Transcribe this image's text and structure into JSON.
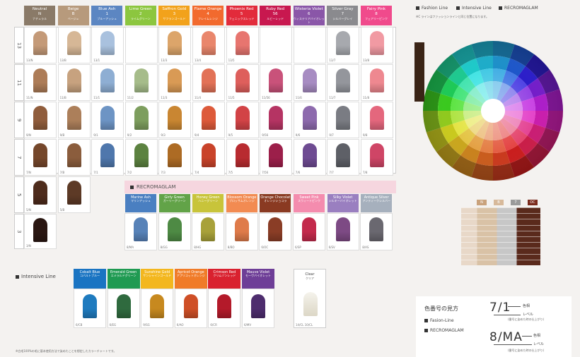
{
  "headers": [
    {
      "name": "Neutral",
      "code": "N",
      "jp": "ナチュラル",
      "color": "#8a7a68"
    },
    {
      "name": "Beige",
      "code": "B",
      "jp": "ベージュ",
      "color": "#b79a7c"
    },
    {
      "name": "Blue Ash",
      "code": "1",
      "jp": "ブルーアッシュ",
      "color": "#5c86c2"
    },
    {
      "name": "Lime Green",
      "code": "2",
      "jp": "ライムグリーン",
      "color": "#8cc63f"
    },
    {
      "name": "Saffron Gold",
      "code": "3",
      "jp": "サフランゴールド",
      "color": "#f2a21b"
    },
    {
      "name": "Flame Orange",
      "code": "4",
      "jp": "フレイムレンジ",
      "color": "#f26a2e"
    },
    {
      "name": "Phoenix Red",
      "code": "5",
      "jp": "フェニックスレッド",
      "color": "#e22b3b"
    },
    {
      "name": "Ruby Red",
      "code": "56",
      "jp": "ルビーレッド",
      "color": "#c8184f"
    },
    {
      "name": "Wisteria Violet",
      "code": "6",
      "jp": "ウィステリアバイオレット",
      "color": "#8a56a8"
    },
    {
      "name": "Silver Gray",
      "code": "7",
      "jp": "シルバーグレイ",
      "color": "#8a8a8e"
    },
    {
      "name": "Fairy Pink",
      "code": "8",
      "jp": "フェアリーピンク",
      "color": "#f04a8c"
    }
  ],
  "levels": [
    "13",
    "11",
    "9",
    "7",
    "5",
    "3"
  ],
  "rows": [
    {
      "cells": [
        {
          "code": "13/N",
          "color": "#c49a78"
        },
        {
          "code": "13/B",
          "color": "#d6b796"
        },
        {
          "code": "13/1",
          "color": "#a9c1de"
        },
        {
          "code": "",
          "color": ""
        },
        {
          "code": "13/3",
          "color": "#dca56a"
        },
        {
          "code": "13/4",
          "color": "#e9866c"
        },
        {
          "code": "13/5",
          "color": "#e7756f"
        },
        {
          "code": "",
          "color": ""
        },
        {
          "code": "",
          "color": ""
        },
        {
          "code": "13/7",
          "color": "#a7a9ae"
        },
        {
          "code": "13/8",
          "color": "#f19aa3"
        }
      ]
    },
    {
      "cells": [
        {
          "code": "11/N",
          "color": "#ad7c57"
        },
        {
          "code": "11/B",
          "color": "#c7a27f"
        },
        {
          "code": "11/1",
          "color": "#8eaed3"
        },
        {
          "code": "11/2",
          "color": "#a6bc8a"
        },
        {
          "code": "11/3",
          "color": "#d99a55"
        },
        {
          "code": "11/4",
          "color": "#e27257"
        },
        {
          "code": "11/5",
          "color": "#de5f5c"
        },
        {
          "code": "11/56",
          "color": "#c9527a"
        },
        {
          "code": "11/6",
          "color": "#a78cc2"
        },
        {
          "code": "11/7",
          "color": "#94969c"
        },
        {
          "code": "11/8",
          "color": "#ee8890"
        }
      ]
    },
    {
      "cells": [
        {
          "code": "9/N",
          "color": "#905d3c"
        },
        {
          "code": "9/B",
          "color": "#ac7f5a"
        },
        {
          "code": "9/1",
          "color": "#6d94c4"
        },
        {
          "code": "9/2",
          "color": "#7d9e5e"
        },
        {
          "code": "9/3",
          "color": "#c98632"
        },
        {
          "code": "9/4",
          "color": "#dd5a3a"
        },
        {
          "code": "9/5",
          "color": "#d24346"
        },
        {
          "code": "9/56",
          "color": "#b53463"
        },
        {
          "code": "9/6",
          "color": "#8d6aad"
        },
        {
          "code": "9/7",
          "color": "#7a7c83"
        },
        {
          "code": "9/8",
          "color": "#e4677d"
        }
      ]
    },
    {
      "cells": [
        {
          "code": "7/N",
          "color": "#75472b"
        },
        {
          "code": "7/B",
          "color": "#8b5d3d"
        },
        {
          "code": "7/1",
          "color": "#4f77ac"
        },
        {
          "code": "7/2",
          "color": "#5c8240"
        },
        {
          "code": "7/3",
          "color": "#ad6b24"
        },
        {
          "code": "7/4",
          "color": "#c9432a"
        },
        {
          "code": "7/5",
          "color": "#b82b30"
        },
        {
          "code": "7/56",
          "color": "#9c1f4a"
        },
        {
          "code": "7/6",
          "color": "#6e4b92"
        },
        {
          "code": "7/7",
          "color": "#5e6067"
        },
        {
          "code": "7/8",
          "color": "#cf4566"
        }
      ]
    },
    {
      "cells": [
        {
          "code": "5/N",
          "color": "#4e2c1c"
        },
        {
          "code": "5/B",
          "color": "#5d3a26"
        }
      ]
    },
    {
      "cells": [
        {
          "code": "3/N",
          "color": "#2a1712"
        }
      ]
    }
  ],
  "recroma": {
    "title": "RECROMAGLAM",
    "items": [
      {
        "name": "Marine Ash",
        "jp": "マリンアッシュ",
        "hcolor": "#4a7fc1",
        "code": "8/MA",
        "color": "#5782b8"
      },
      {
        "name": "Girly Green",
        "jp": "ガーリーグリーン",
        "hcolor": "#62a348",
        "code": "8/GG",
        "color": "#4e8a44"
      },
      {
        "name": "Honey Green",
        "jp": "ハニーグリーン",
        "hcolor": "#c8c43a",
        "code": "8/HG",
        "color": "#a8a13a"
      },
      {
        "name": "Blossom Orange",
        "jp": "ブロッサムオレンジ",
        "hcolor": "#f28b52",
        "code": "8/BO",
        "color": "#df7b4a"
      },
      {
        "name": "Orange Chocolat",
        "jp": "オレンジショコラ",
        "hcolor": "#8a3a22",
        "code": "6/OC",
        "color": "#8a3d26"
      },
      {
        "name": "Sweet Pink",
        "jp": "スウィートピンク",
        "hcolor": "#f48cae",
        "code": "6/SP",
        "color": "#c32a4c"
      },
      {
        "name": "Silky Violet",
        "jp": "シルキーバイオレット",
        "hcolor": "#9a7fc0",
        "code": "6/SV",
        "color": "#7d4a84"
      },
      {
        "name": "Antique Silver",
        "jp": "アンティークシルバー",
        "hcolor": "#a6b0bd",
        "code": "8/AS",
        "color": "#6a6870"
      }
    ]
  },
  "intensive": {
    "title": "Intensive Line",
    "items": [
      {
        "name": "Cobalt Blue",
        "jp": "コバルトブルー",
        "hcolor": "#1a74c2",
        "code": "6/CB",
        "color": "#1f7bbf"
      },
      {
        "name": "Emerald Green",
        "jp": "エメラルドグリーン",
        "hcolor": "#1f9a52",
        "code": "6/EG",
        "color": "#2f6a3e"
      },
      {
        "name": "Sunshine Gold",
        "jp": "サンシャインゴールド",
        "hcolor": "#f3b71e",
        "code": "9/SG",
        "color": "#c7891f"
      },
      {
        "name": "Apricot Orange",
        "jp": "アプリコットオレンジ",
        "hcolor": "#f07b28",
        "code": "6/AO",
        "color": "#cf4f26"
      },
      {
        "name": "Crimson Red",
        "jp": "クリムゾンレッド",
        "hcolor": "#d9212f",
        "code": "6/CR",
        "color": "#b41a2a"
      },
      {
        "name": "Mauve Violet",
        "jp": "モーヴバイオレット",
        "hcolor": "#6e3e97",
        "code": "6/MV",
        "color": "#4e2d6e"
      }
    ],
    "clear": {
      "name": "Clear",
      "jp": "クリア",
      "code": "14/CL 10/CL",
      "color": "#e9e6dc"
    }
  },
  "legend": {
    "fashion": "Fashion Line",
    "intensive": "Intensive Line",
    "recroma": "RECROMAGLAM",
    "note": "※C ラインはファッションラインと同じ位置になります。"
  },
  "mini_headers": [
    {
      "code": "N",
      "color": "#c9a27c"
    },
    {
      "code": "B",
      "color": "#d7b99a"
    },
    {
      "code": "7",
      "color": "#9a9a9a"
    },
    {
      "code": "OC",
      "color": "#7a2a1c"
    }
  ],
  "howto": {
    "title": "色番号の見方",
    "fashion": "Fasion-Line",
    "recroma": "RECROMAGLAM",
    "ex1": "7/1",
    "ex1_a": "色相",
    "ex1_b": "レベル",
    "ex1_c": "(番号に染めた時の仕上がり)",
    "ex2": "8/MA",
    "ex2_a": "色相",
    "ex2_b": "レベル",
    "ex2_c": "(番号に染めた時の仕上がり)"
  },
  "footnote": "※白毛100%の毛に基本使用方法で染めたことを想定したカラーチャートです。"
}
